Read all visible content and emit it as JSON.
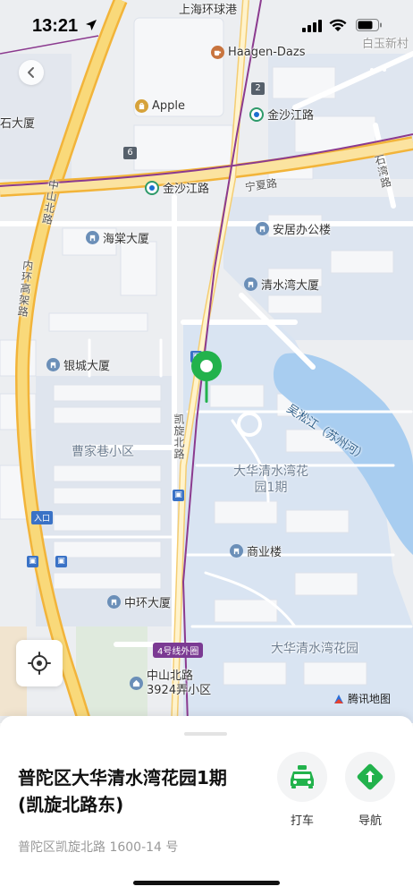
{
  "status_bar": {
    "time": "13:21"
  },
  "map": {
    "labels": {
      "shanghai_global_harbor": "上海环球港",
      "haagen_dazs": "Haagen-Dazs",
      "apple": "Apple",
      "jinshajiang_rd_station_top": "金沙江路",
      "jinshajiang_rd_station": "金沙江路",
      "baiyu_xincun": "白玉新村",
      "shi_building": "石大厦",
      "ningxia_rd": "宁夏路",
      "shiwan_rd": "石湾路",
      "zhongshan_north_rd": "中山北路",
      "inner_ring_elevated": "内环高架路",
      "haitang_building": "海棠大厦",
      "anju_office": "安居办公楼",
      "qingshuiwan_building": "清水湾大厦",
      "yincheng_building": "银城大厦",
      "wusong_river": "吴淞江（苏州河）",
      "kaixuan_north_rd": "凯旋北路",
      "caojiaxiang": "曹家巷小区",
      "dahua_phase1": "大华清水湾花园1期",
      "commercial_building": "商业楼",
      "zhonghuan_building": "中环大厦",
      "dahua_garden": "大华清水湾花园",
      "zhongshan_3924": "中山北路\n3924弄小区",
      "line4_badge": "4号线外圈",
      "entrance_badge": "入口",
      "shield_2": "2",
      "shield_6": "6"
    },
    "attribution": "腾讯地图",
    "colors": {
      "pin": "#22b24c",
      "expressway": "#f6c24c",
      "river": "#a8cdf0",
      "metro_line": "#8b3a8f",
      "poi": "#6b8fb8"
    }
  },
  "place": {
    "title": "普陀区大华清水湾花园1期 (凯旋北路东)",
    "address": "普陀区凯旋北路 1600-14 号"
  },
  "actions": [
    {
      "label": "打车",
      "icon": "taxi-icon"
    },
    {
      "label": "导航",
      "icon": "navigation-icon"
    }
  ]
}
